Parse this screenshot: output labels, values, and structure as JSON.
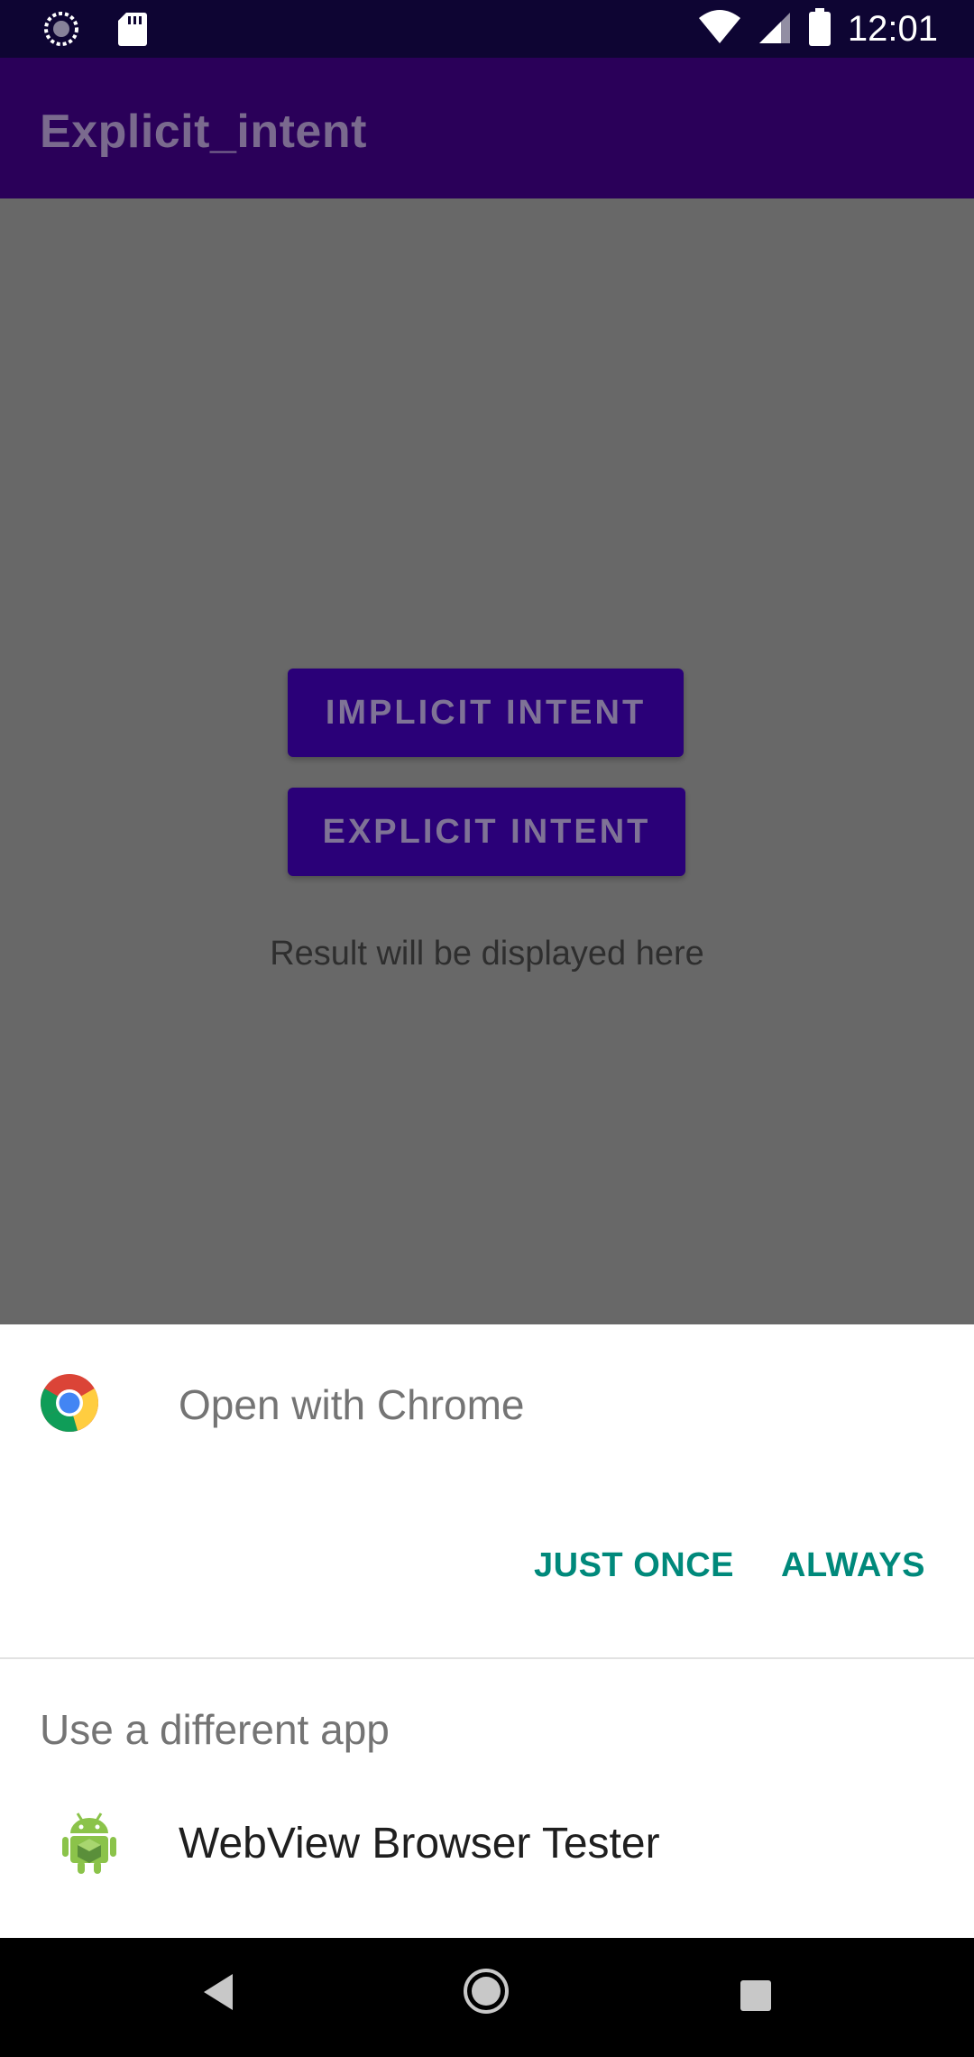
{
  "status_bar": {
    "time": "12:01",
    "icons": [
      "sync-icon",
      "sd-card-icon",
      "wifi-icon",
      "signal-icon",
      "battery-icon"
    ]
  },
  "app_bar": {
    "title": "Explicit_intent"
  },
  "content": {
    "implicit_button": "IMPLICIT INTENT",
    "explicit_button": "EXPLICIT INTENT",
    "result_text": "Result will be displayed here"
  },
  "sheet": {
    "open_with": "Open with Chrome",
    "just_once": "JUST ONCE",
    "always": "ALWAYS",
    "use_different_app": "Use a different app",
    "apps": [
      {
        "label": "WebView Browser Tester",
        "icon": "android-icon"
      }
    ]
  },
  "nav_bar": {
    "buttons": [
      "back-icon",
      "home-icon",
      "recents-icon"
    ]
  },
  "colors": {
    "status_bar": "#0e0533",
    "app_bar": "#2a0059",
    "scrim": "#686868",
    "button": "#2a0078",
    "accent": "#00897b"
  }
}
